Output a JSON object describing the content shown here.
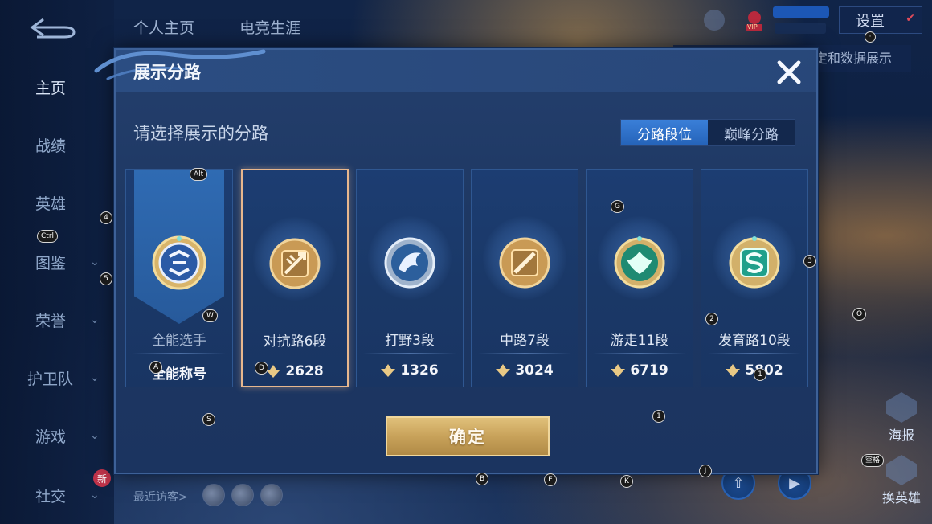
{
  "background": {
    "top_tabs": [
      "个人主页",
      "电竞生涯"
    ],
    "settings_label": "设置",
    "data_display_label": "定和数据展示",
    "vip_label": "VIP",
    "recent_visitors_label": "最近访客>",
    "nav": [
      {
        "label": "主页",
        "has_chevron": false,
        "active": true
      },
      {
        "label": "战绩",
        "has_chevron": false,
        "active": false
      },
      {
        "label": "英雄",
        "has_chevron": false,
        "active": false
      },
      {
        "label": "图鉴",
        "has_chevron": true,
        "active": false
      },
      {
        "label": "荣誉",
        "has_chevron": true,
        "active": false
      },
      {
        "label": "护卫队",
        "has_chevron": true,
        "active": false
      },
      {
        "label": "游戏",
        "has_chevron": true,
        "active": false
      },
      {
        "label": "社交",
        "has_chevron": true,
        "active": false,
        "badge": "新"
      }
    ],
    "side_buttons": [
      "海报",
      "换英雄"
    ]
  },
  "modal": {
    "title": "展示分路",
    "prompt": "请选择展示的分路",
    "toggle": {
      "options": [
        "分路段位",
        "巅峰分路"
      ],
      "selected_index": 0
    },
    "cards": [
      {
        "name": "全能选手",
        "bottom": "全能称号",
        "score": null,
        "emblem": "all-round-emblem",
        "selected": false
      },
      {
        "name": "对抗路6段",
        "bottom": "2628",
        "score": 2628,
        "emblem": "clash-lane-emblem",
        "selected": true
      },
      {
        "name": "打野3段",
        "bottom": "1326",
        "score": 1326,
        "emblem": "jungle-emblem",
        "selected": false
      },
      {
        "name": "中路7段",
        "bottom": "3024",
        "score": 3024,
        "emblem": "mid-lane-emblem",
        "selected": false
      },
      {
        "name": "游走11段",
        "bottom": "6719",
        "score": 6719,
        "emblem": "roam-emblem",
        "selected": false
      },
      {
        "name": "发育路10段",
        "bottom": "5802",
        "score": 5802,
        "emblem": "farm-lane-emblem",
        "selected": false
      }
    ],
    "confirm_label": "确定"
  },
  "key_hints": [
    {
      "key": "Alt"
    },
    {
      "key": "4"
    },
    {
      "key": "Ctrl"
    },
    {
      "key": "5"
    },
    {
      "key": "W"
    },
    {
      "key": "A"
    },
    {
      "key": "D"
    },
    {
      "key": "S"
    },
    {
      "key": "G"
    },
    {
      "key": "3"
    },
    {
      "key": "2"
    },
    {
      "key": "O"
    },
    {
      "key": "1"
    },
    {
      "key": "1"
    },
    {
      "key": "B"
    },
    {
      "key": "E"
    },
    {
      "key": "K"
    },
    {
      "key": "J"
    },
    {
      "key": "空格"
    }
  ],
  "colors": {
    "accent_gold": "#e0c07a",
    "selected_border": "#e7b78e",
    "toggle_active": "#3a7fd8"
  }
}
